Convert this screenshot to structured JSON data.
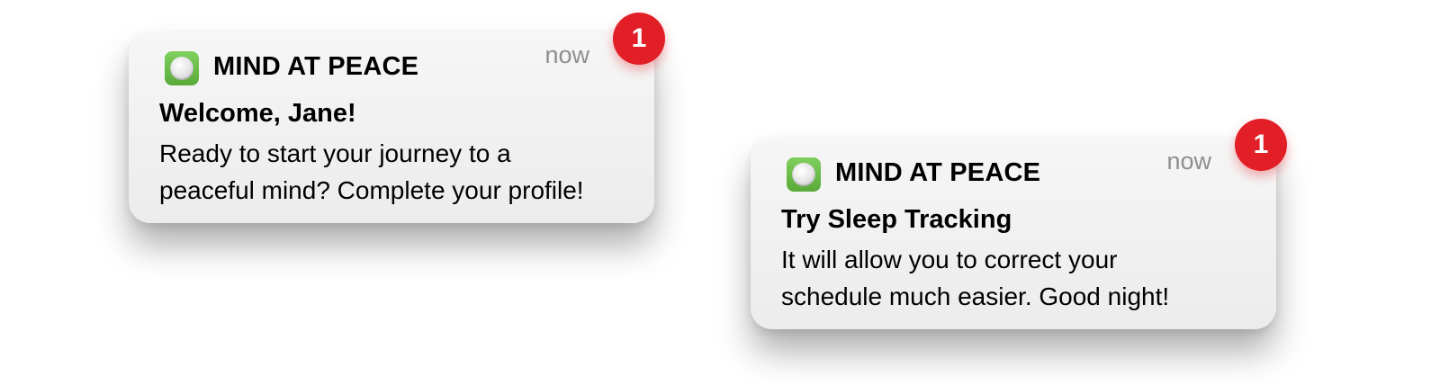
{
  "notifications": [
    {
      "app_name": "MIND AT PEACE",
      "time": "now",
      "badge_count": "1",
      "title": "Welcome, Jane!",
      "body_lines": [
        "Ready to start your journey to a",
        "peaceful mind? Complete your profile!"
      ]
    },
    {
      "app_name": "MIND AT PEACE",
      "time": "now",
      "badge_count": "1",
      "title": "Try Sleep Tracking",
      "body_lines": [
        "It will allow you to correct your",
        "schedule much easier. Good night!"
      ]
    }
  ],
  "colors": {
    "badge": "#e21e26",
    "app_icon": "#6cbf4a",
    "time_text": "#8e8e8e"
  },
  "icons": {
    "app_icon": "mind-at-peace-app-icon"
  }
}
